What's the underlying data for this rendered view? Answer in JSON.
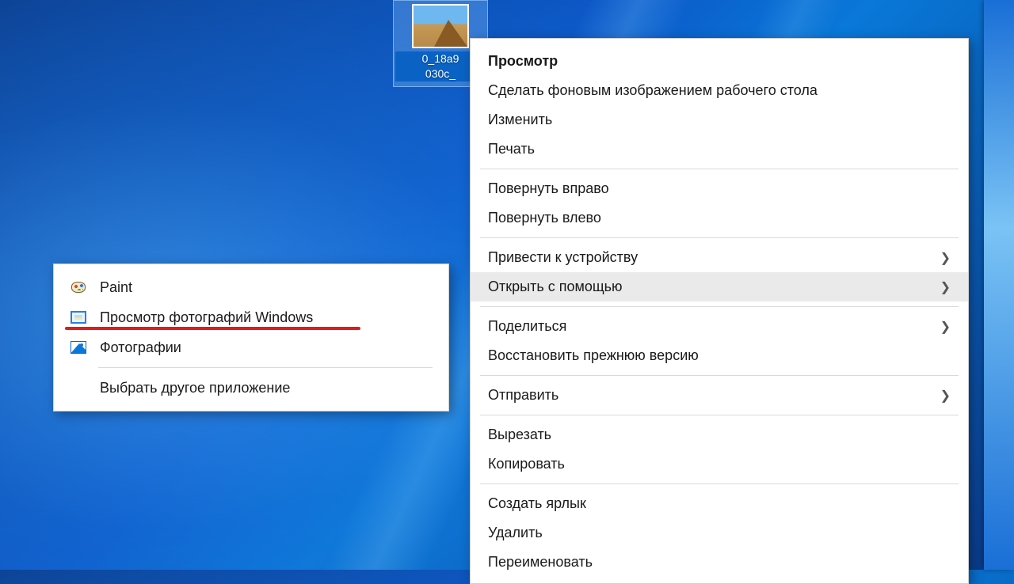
{
  "desktop_icon": {
    "label_line1": "0_18a9",
    "label_line2": "030c_"
  },
  "context_menu": {
    "groups": [
      [
        {
          "label": "Просмотр",
          "bold": true,
          "arrow": false
        },
        {
          "label": "Сделать фоновым изображением рабочего стола",
          "arrow": false
        },
        {
          "label": "Изменить",
          "arrow": false
        },
        {
          "label": "Печать",
          "arrow": false
        }
      ],
      [
        {
          "label": "Повернуть вправо",
          "arrow": false
        },
        {
          "label": "Повернуть влево",
          "arrow": false
        }
      ],
      [
        {
          "label": "Привести к устройству",
          "arrow": true
        },
        {
          "label": "Открыть с помощью",
          "arrow": true,
          "hover": true
        }
      ],
      [
        {
          "label": "Поделиться",
          "arrow": true
        },
        {
          "label": "Восстановить прежнюю версию",
          "arrow": false
        }
      ],
      [
        {
          "label": "Отправить",
          "arrow": true
        }
      ],
      [
        {
          "label": "Вырезать",
          "arrow": false
        },
        {
          "label": "Копировать",
          "arrow": false
        }
      ],
      [
        {
          "label": "Создать ярлык",
          "arrow": false
        },
        {
          "label": "Удалить",
          "arrow": false
        },
        {
          "label": "Переименовать",
          "arrow": false
        }
      ]
    ]
  },
  "open_with_submenu": {
    "items": [
      {
        "label": "Paint",
        "icon": "paint"
      },
      {
        "label": "Просмотр фотографий Windows",
        "icon": "viewer",
        "annotated": true
      },
      {
        "label": "Фотографии",
        "icon": "photos"
      }
    ],
    "choose_another": "Выбрать другое приложение"
  }
}
